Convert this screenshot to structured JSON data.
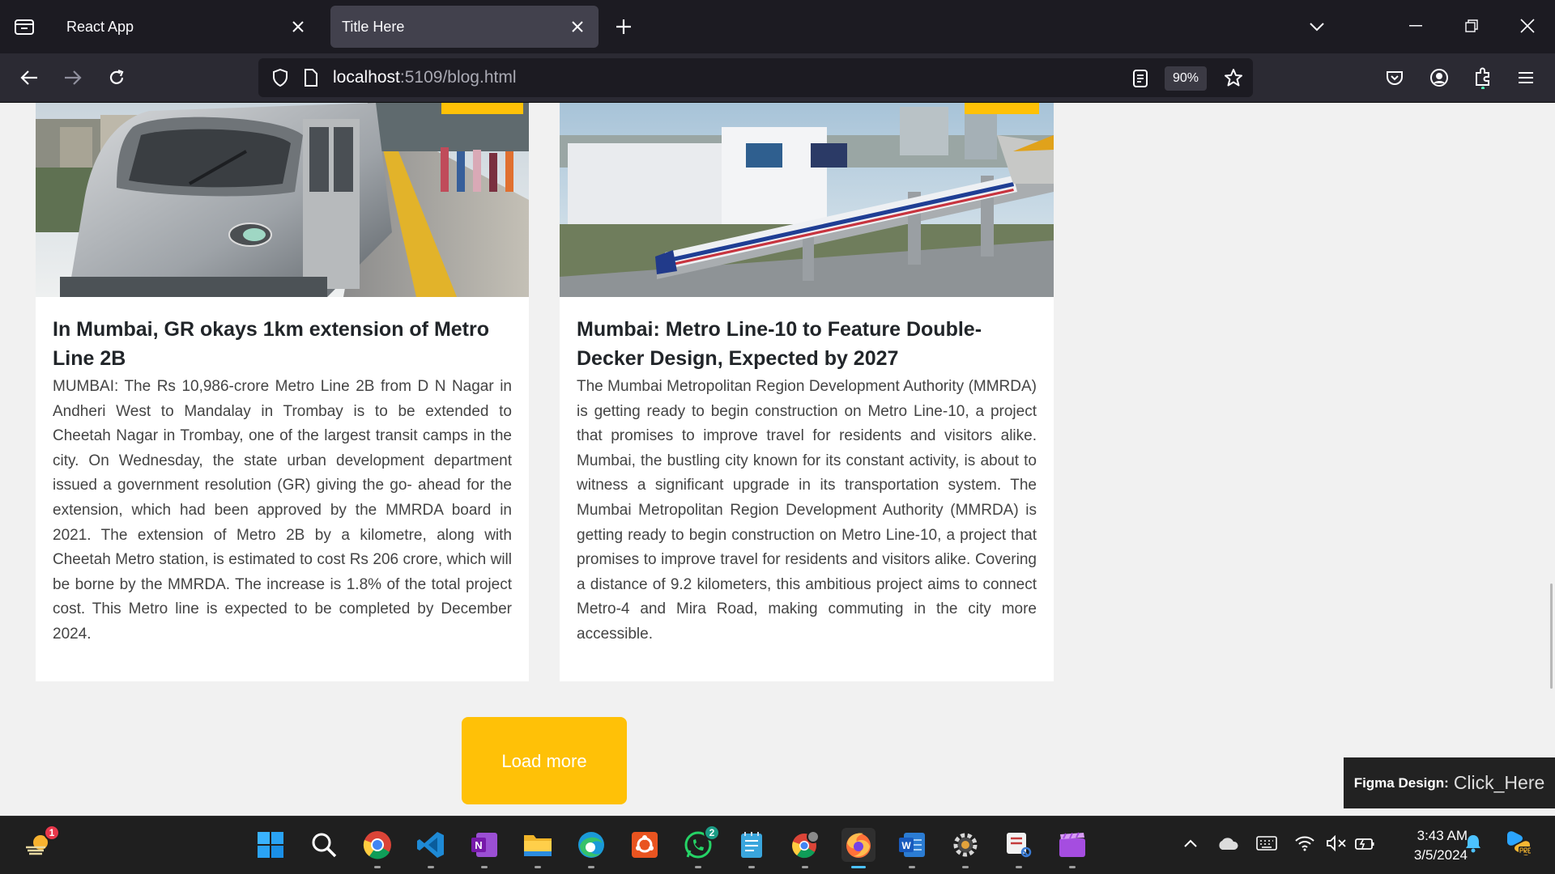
{
  "browser": {
    "tabs": [
      {
        "title": "React App",
        "active": false
      },
      {
        "title": "Title Here",
        "active": true
      }
    ],
    "url": {
      "host": "localhost",
      "rest": ":5109/blog.html"
    },
    "zoom": "90%"
  },
  "cards": [
    {
      "title": "In Mumbai, GR okays 1km extension of Metro Line 2B",
      "body": "MUMBAI: The Rs 10,986-crore Metro Line 2B from D N Nagar in Andheri West to Mandalay in Trombay is to be extended to Cheetah Nagar in Trombay, one of the largest transit camps in the city. On Wednesday, the state urban development department issued a government resolution (GR) giving the go- ahead for the extension, which had been approved by the MMRDA board in 2021. The extension of Metro 2B by a kilometre, along with Cheetah Metro station, is estimated to cost Rs 206 crore, which will be borne by the MMRDA. The increase is 1.8% of the total project cost. This Metro line is expected to be completed by December 2024.",
      "image": "metro-train-platform"
    },
    {
      "title": "Mumbai: Metro Line-10 to Feature Double-Decker Design, Expected by 2027",
      "body": "The Mumbai Metropolitan Region Development Authority (MMRDA) is getting ready to begin construction on Metro Line-10, a project that promises to improve travel for residents and visitors alike. Mumbai, the bustling city known for its constant activity, is about to witness a significant upgrade in its transportation system. The Mumbai Metropolitan Region Development Authority (MMRDA) is getting ready to begin construction on Metro Line-10, a project that promises to improve travel for residents and visitors alike. Covering a distance of 9.2 kilometers, this ambitious project aims to connect Metro-4 and Mira Road, making commuting in the city more accessible.",
      "image": "elevated-metro-viaduct"
    }
  ],
  "load_more": "Load more",
  "figma": {
    "label": "Figma Design:",
    "link": "Click_Here"
  },
  "taskbar": {
    "widgets_badge": "1",
    "whatsapp_badge": "2",
    "time": "3:43 AM",
    "date": "3/5/2024"
  },
  "colors": {
    "accent": "#ffc107",
    "chrome_dark": "#1c1b22",
    "chrome_nav": "#2b2a33",
    "page_bg": "#f1f1f1"
  }
}
